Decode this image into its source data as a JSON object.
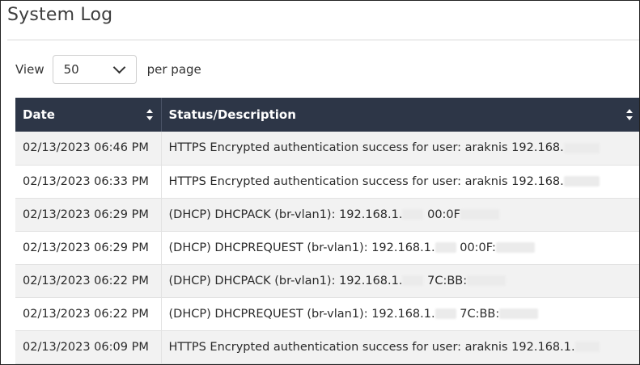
{
  "page": {
    "title": "System Log"
  },
  "pagination": {
    "view_label": "View",
    "per_page_value": "50",
    "per_page_suffix": "per page"
  },
  "table": {
    "columns": [
      {
        "label": "Date"
      },
      {
        "label": "Status/Description"
      }
    ],
    "rows": [
      {
        "date": "02/13/2023 06:46 PM",
        "text": "HTTPS Encrypted authentication success for user: araknis 192.168."
      },
      {
        "date": "02/13/2023 06:33 PM",
        "text": "HTTPS Encrypted authentication success for user: araknis 192.168."
      },
      {
        "date": "02/13/2023 06:29 PM",
        "text": "(DHCP) DHCPACK (br-vlan1): 192.168.1.",
        "mac": "00:0F"
      },
      {
        "date": "02/13/2023 06:29 PM",
        "text": "(DHCP) DHCPREQUEST (br-vlan1): 192.168.1.",
        "mac": "00:0F:"
      },
      {
        "date": "02/13/2023 06:22 PM",
        "text": "(DHCP) DHCPACK (br-vlan1): 192.168.1.",
        "mac": "7C:BB:"
      },
      {
        "date": "02/13/2023 06:22 PM",
        "text": "(DHCP) DHCPREQUEST (br-vlan1): 192.168.1.",
        "mac": "7C:BB:"
      },
      {
        "date": "02/13/2023 06:09 PM",
        "text": "HTTPS Encrypted authentication success for user: araknis 192.168.1."
      }
    ]
  }
}
